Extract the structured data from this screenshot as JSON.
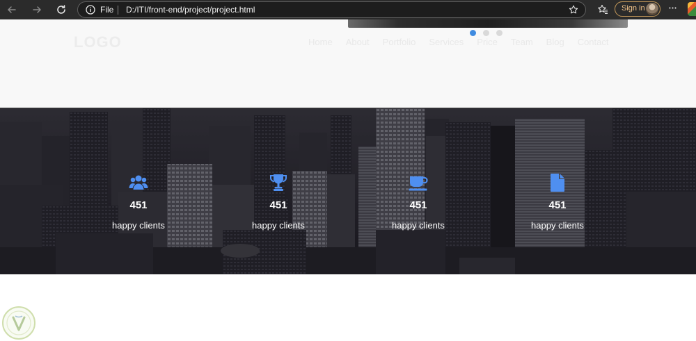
{
  "browser": {
    "address": {
      "scheme_label": "File",
      "url": "D:/ITI/front-end/project/project.html"
    },
    "signin_label": "Sign in",
    "menu_label": "···"
  },
  "site": {
    "logo": "LOGO",
    "nav": [
      "Home",
      "About",
      "Portfolio",
      "Services",
      "Price",
      "Team",
      "Blog",
      "Contact"
    ],
    "slider_dots": {
      "count": 3,
      "active": 0
    }
  },
  "counters": [
    {
      "icon": "users-icon",
      "number": "451",
      "label": "happy clients"
    },
    {
      "icon": "trophy-icon",
      "number": "451",
      "label": "happy clients"
    },
    {
      "icon": "coffee-cup-icon",
      "number": "451",
      "label": "happy clients"
    },
    {
      "icon": "file-icon",
      "number": "451",
      "label": "happy clients"
    }
  ],
  "colors": {
    "accent": "#4f8ff0",
    "active_dot": "#3f8be0",
    "chrome_bg": "#2b2b2b",
    "signin_border": "#c69a5a"
  }
}
